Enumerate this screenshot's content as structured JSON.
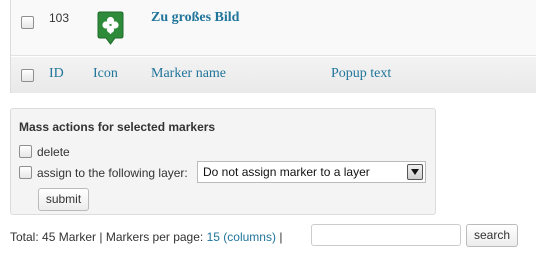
{
  "table": {
    "row": {
      "id": "103",
      "icon": "green-clover-map-marker-icon",
      "marker_name": "Zu großes Bild"
    },
    "columns": {
      "id": "ID",
      "icon": "Icon",
      "marker_name": "Marker name",
      "popup_text": "Popup text"
    }
  },
  "mass_actions": {
    "title": "Mass actions for selected markers",
    "delete_label": "delete",
    "assign_label": "assign to the following layer:",
    "layer_select_value": "Do not assign marker to a layer",
    "submit_label": "submit"
  },
  "footer": {
    "total": "Total: 45 Marker",
    "separator": "|",
    "per_page_label": "Markers per page:",
    "per_page_value": "15",
    "columns_link": "(columns)",
    "search_value": "",
    "search_label": "search"
  },
  "colors": {
    "link": "#21759b",
    "marker_green": "#2e8b3a"
  }
}
